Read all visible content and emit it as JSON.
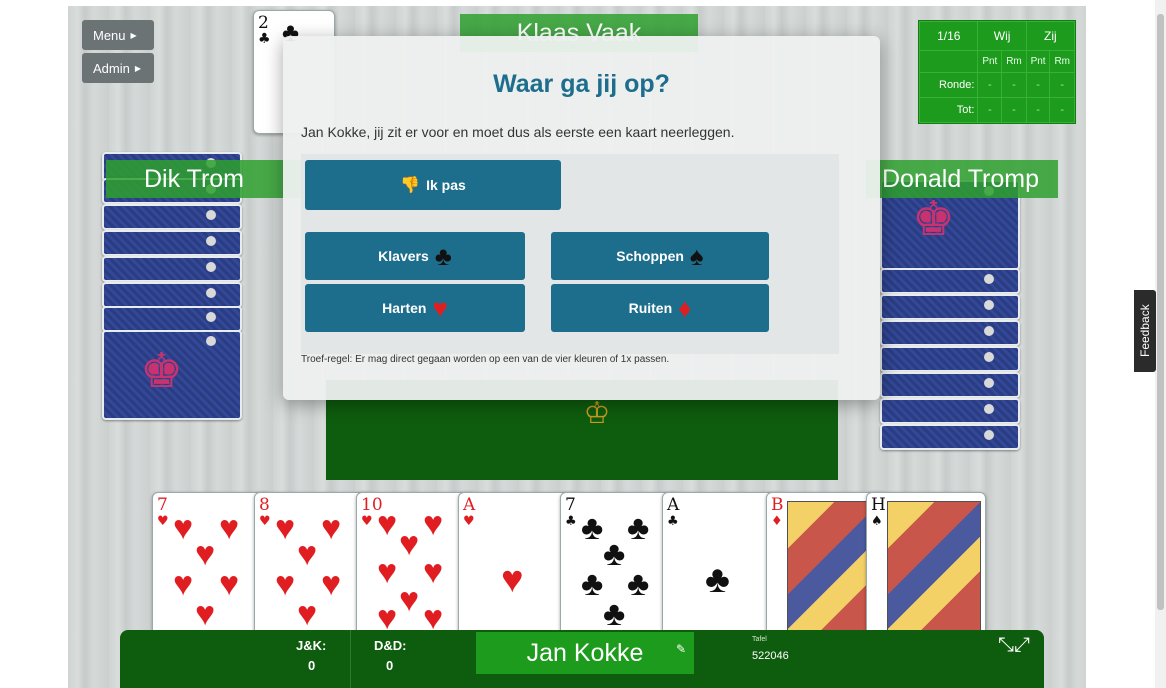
{
  "menu": {
    "menu_label": "Menu",
    "admin_label": "Admin"
  },
  "players": {
    "top": "Klaas Vaak",
    "left": "Dik Trom",
    "right": "Donald Tromp",
    "self": "Jan Kokke"
  },
  "score": {
    "round": "1/16",
    "team_us": "Wij",
    "team_them": "Zij",
    "col_points": "Pnt",
    "col_roem": "Rm",
    "row_round": "Ronde:",
    "row_total": "Tot:",
    "empty": "-"
  },
  "dialog": {
    "title": "Waar ga jij op?",
    "message": "Jan Kokke, jij zit er voor en moet dus als eerste een kaart neerleggen.",
    "pass_label": "Ik pas",
    "suits": [
      {
        "label": "Klavers",
        "symbol": "♣",
        "color": "#111111"
      },
      {
        "label": "Schoppen",
        "symbol": "♠",
        "color": "#111111"
      },
      {
        "label": "Harten",
        "symbol": "♥",
        "color": "#e01e22"
      },
      {
        "label": "Ruiten",
        "symbol": "♦",
        "color": "#e01e22"
      }
    ],
    "rule": "Troef-regel: Er mag direct gegaan worden op een van de vier kleuren of 1x passen."
  },
  "played_card": {
    "rank": "2",
    "suit": "♣"
  },
  "hand": [
    {
      "rank": "7",
      "suit": "♥"
    },
    {
      "rank": "8",
      "suit": "♥"
    },
    {
      "rank": "10",
      "suit": "♥"
    },
    {
      "rank": "A",
      "suit": "♥"
    },
    {
      "rank": "7",
      "suit": "♣"
    },
    {
      "rank": "A",
      "suit": "♣"
    },
    {
      "rank": "B",
      "suit": "♦"
    },
    {
      "rank": "H",
      "suit": "♠"
    }
  ],
  "stats": {
    "jk_label": "J&K:",
    "jk_value": "0",
    "dd_label": "D&D:",
    "dd_value": "0",
    "table_label": "Tafel",
    "table_value": "522046"
  },
  "feedback_label": "Feedback",
  "icons": {
    "caret": "caret-right-icon",
    "thumbs_down": "thumbs-down-icon",
    "edit": "pencil-icon",
    "expand": "expand-icon"
  },
  "colors": {
    "felt": "#0e5c0e",
    "banner": "#2ea02e",
    "button": "#1d6e8c",
    "title": "#1d6e8c"
  }
}
